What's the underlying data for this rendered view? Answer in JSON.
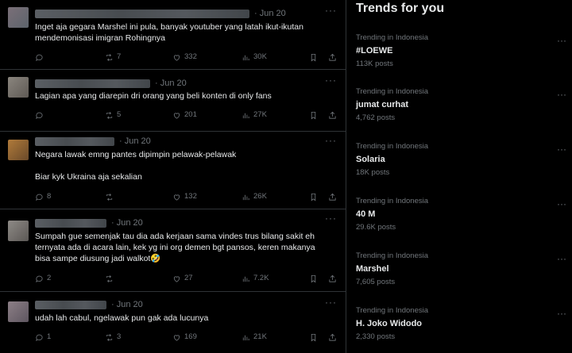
{
  "tweets": [
    {
      "date": "· Jun 20",
      "text": "Inget aja gegara Marshel ini pula, banyak youtuber yang latah ikut-ikutan\nmendemonisasi imigran Rohingnya",
      "reply": "",
      "retweet": "7",
      "like": "332",
      "views": "30K"
    },
    {
      "date": "· Jun 20",
      "text": "Lagian apa yang diarepin dri orang yang beli konten di only fans",
      "reply": "",
      "retweet": "5",
      "like": "201",
      "views": "27K"
    },
    {
      "date": "· Jun 20",
      "text": "Negara lawak emng pantes dipimpin pelawak-pelawak\n\nBiar kyk Ukraina aja sekalian",
      "reply": "8",
      "retweet": "",
      "like": "132",
      "views": "26K"
    },
    {
      "date": "· Jun 20",
      "text": "Sumpah gue semenjak tau dia ada kerjaan sama vindes trus bilang sakit eh\nternyata ada di acara lain, kek yg ini org demen bgt pansos, keren makanya\nbisa sampe diusung jadi walkot🤣",
      "reply": "2",
      "retweet": "",
      "like": "27",
      "views": "7.2K"
    },
    {
      "date": "· Jun 20",
      "text": "udah lah cabul, ngelawak pun gak ada lucunya",
      "reply": "1",
      "retweet": "3",
      "like": "169",
      "views": "21K"
    }
  ],
  "trends": {
    "title": "Trends for you",
    "items": [
      {
        "context": "Trending in Indonesia",
        "name": "#LOEWE",
        "posts": "113K posts"
      },
      {
        "context": "Trending in Indonesia",
        "name": "jumat curhat",
        "posts": "4,762 posts"
      },
      {
        "context": "Trending in Indonesia",
        "name": "Solaria",
        "posts": "18K posts"
      },
      {
        "context": "Trending in Indonesia",
        "name": "40 M",
        "posts": "29.6K posts"
      },
      {
        "context": "Trending in Indonesia",
        "name": "Marshel",
        "posts": "7,605 posts"
      },
      {
        "context": "Trending in Indonesia",
        "name": "H. Joko Widodo",
        "posts": "2,330 posts"
      }
    ]
  },
  "colors": {
    "background": "#000000",
    "text": "#e7e9ea",
    "muted": "#71767b",
    "border": "#2f3336"
  },
  "icons": [
    "reply-icon",
    "retweet-icon",
    "like-icon",
    "views-icon",
    "bookmark-icon",
    "share-icon",
    "more-icon"
  ]
}
